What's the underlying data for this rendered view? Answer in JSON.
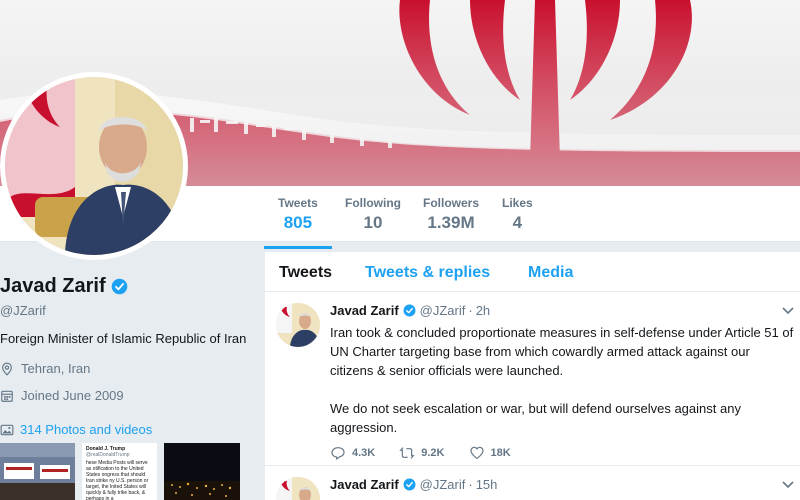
{
  "nav": {
    "stats": [
      {
        "label": "Tweets",
        "value": "805"
      },
      {
        "label": "Following",
        "value": "10"
      },
      {
        "label": "Followers",
        "value": "1.39M"
      },
      {
        "label": "Likes",
        "value": "4"
      }
    ]
  },
  "profile": {
    "name": "Javad Zarif",
    "handle": "@JZarif",
    "bio": "Foreign Minister of Islamic Republic of Iran",
    "location": "Tehran, Iran",
    "joined": "Joined June 2009",
    "photos_label": "314 Photos and videos",
    "thumb_texts": [
      "Donald J. Trump",
      "@realDonaldTrump",
      "hese Media Posts will serve as otification to the United States ongress that should Iran strike ny U.S. person or target, the Inited States will quickly & fully trike back, & perhaps in a"
    ]
  },
  "timeline": {
    "tabs": [
      "Tweets",
      "Tweets & replies",
      "Media"
    ],
    "tweets": [
      {
        "name": "Javad Zarif",
        "handle": "@JZarif",
        "sep": "·",
        "time": "2h",
        "text": "Iran took & concluded proportionate measures in self-defense under Article 51 of UN Charter targeting base from which cowardly armed attack against our citizens & senior officials were launched.\n\nWe do not seek escalation or war, but will defend ourselves against any aggression.",
        "replies": "4.3K",
        "retweets": "9.2K",
        "likes": "18K"
      },
      {
        "name": "Javad Zarif",
        "handle": "@JZarif",
        "sep": "·",
        "time": "15h"
      }
    ]
  },
  "colors": {
    "accent": "#1da1f2",
    "muted": "#657786",
    "text": "#14171a",
    "flag_red": "#c8102e",
    "flag_green": "#239f40"
  }
}
